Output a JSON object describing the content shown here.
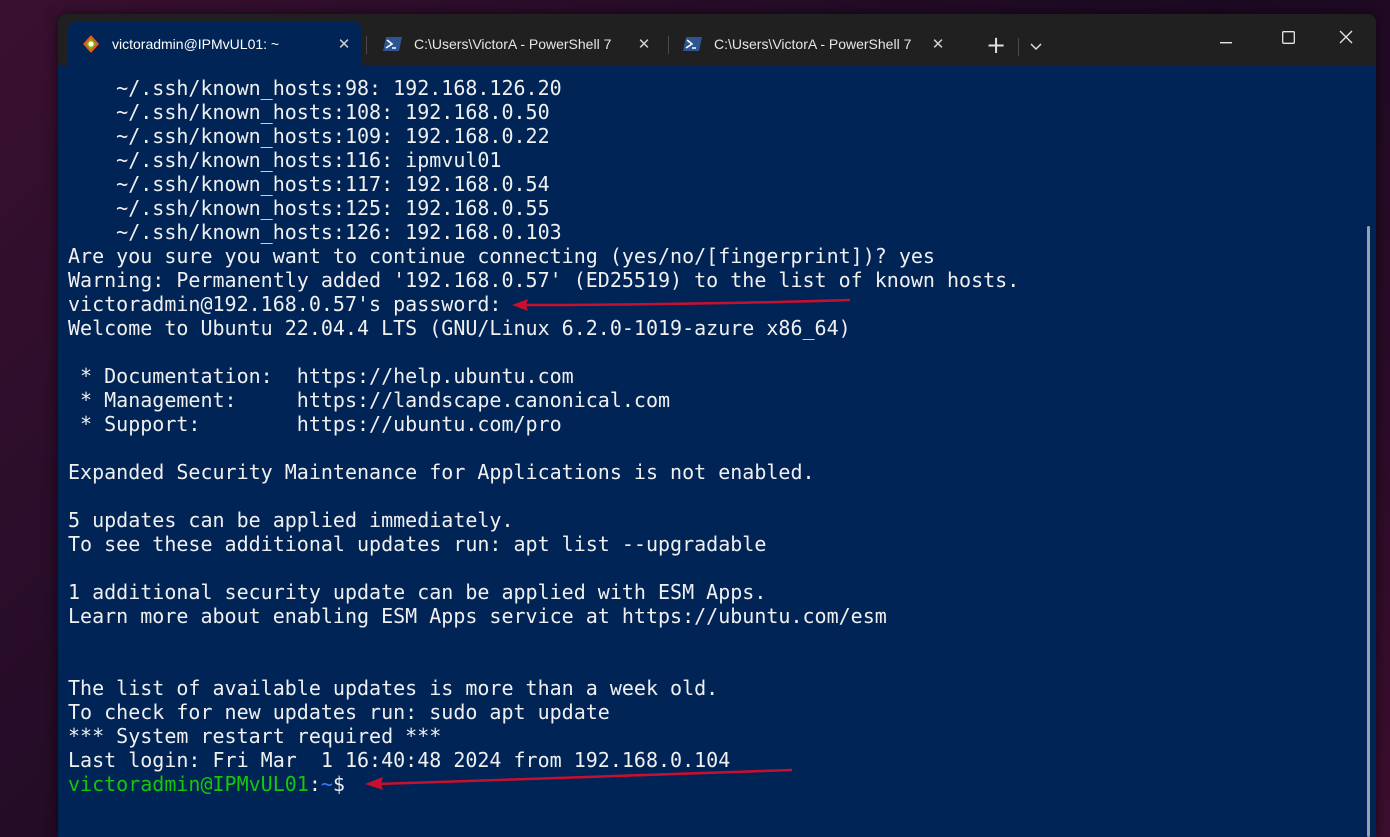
{
  "tabs": [
    {
      "title": "victoradmin@IPMvUL01: ~",
      "icon": "linux-penguin-icon",
      "active": true
    },
    {
      "title": "C:\\Users\\VictorA - PowerShell 7",
      "icon": "powershell-icon",
      "active": false
    },
    {
      "title": "C:\\Users\\VictorA - PowerShell 7",
      "icon": "powershell-icon",
      "active": false
    }
  ],
  "toolbar": {
    "new_tab": "+",
    "dropdown": "⌄"
  },
  "window_controls": {
    "minimize": "—",
    "maximize": "☐",
    "close": "✕"
  },
  "terminal": {
    "lines": [
      "    ~/.ssh/known_hosts:98: 192.168.126.20",
      "    ~/.ssh/known_hosts:108: 192.168.0.50",
      "    ~/.ssh/known_hosts:109: 192.168.0.22",
      "    ~/.ssh/known_hosts:116: ipmvul01",
      "    ~/.ssh/known_hosts:117: 192.168.0.54",
      "    ~/.ssh/known_hosts:125: 192.168.0.55",
      "    ~/.ssh/known_hosts:126: 192.168.0.103",
      "Are you sure you want to continue connecting (yes/no/[fingerprint])? yes",
      "Warning: Permanently added '192.168.0.57' (ED25519) to the list of known hosts.",
      "victoradmin@192.168.0.57's password:",
      "Welcome to Ubuntu 22.04.4 LTS (GNU/Linux 6.2.0-1019-azure x86_64)",
      "",
      " * Documentation:  https://help.ubuntu.com",
      " * Management:     https://landscape.canonical.com",
      " * Support:        https://ubuntu.com/pro",
      "",
      "Expanded Security Maintenance for Applications is not enabled.",
      "",
      "5 updates can be applied immediately.",
      "To see these additional updates run: apt list --upgradable",
      "",
      "1 additional security update can be applied with ESM Apps.",
      "Learn more about enabling ESM Apps service at https://ubuntu.com/esm",
      "",
      "",
      "The list of available updates is more than a week old.",
      "To check for new updates run: sudo apt update",
      "*** System restart required ***",
      "Last login: Fri Mar  1 16:40:48 2024 from 192.168.0.104"
    ],
    "prompt": {
      "user": "victoradmin@IPMvUL01",
      "sep": ":",
      "path": "~",
      "sign": "$"
    }
  },
  "colors": {
    "background": "#012456",
    "prompt_user": "#13c70a",
    "prompt_path": "#3b78ff",
    "annotation_arrow": "#c8102e"
  }
}
